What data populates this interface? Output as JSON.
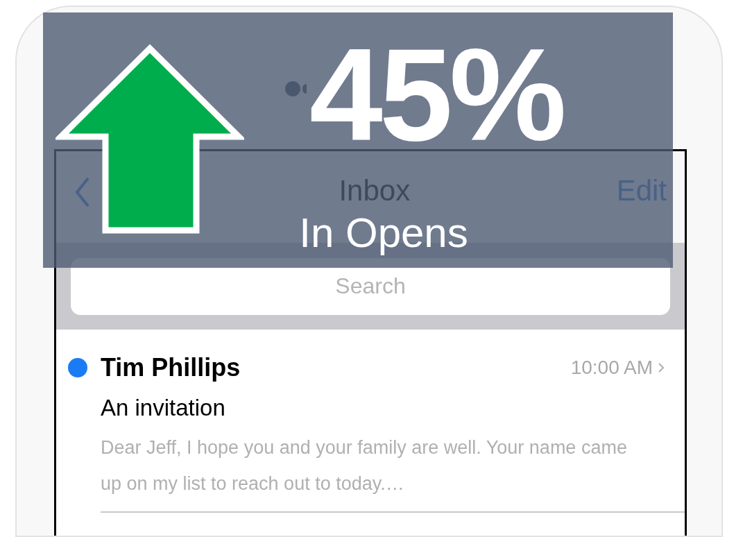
{
  "banner": {
    "figure": "45%",
    "caption": "In Opens"
  },
  "nav_bar": {
    "title": "Inbox",
    "action": "Edit"
  },
  "search": {
    "placeholder": "Search"
  },
  "messages": [
    {
      "sender": "Tim Phillips",
      "time": "10:00 AM",
      "subject": "An invitation",
      "preview": "Dear Jeff, I hope you and your family are well. Your name came up on my list to reach out to today.…",
      "unread": true
    }
  ]
}
